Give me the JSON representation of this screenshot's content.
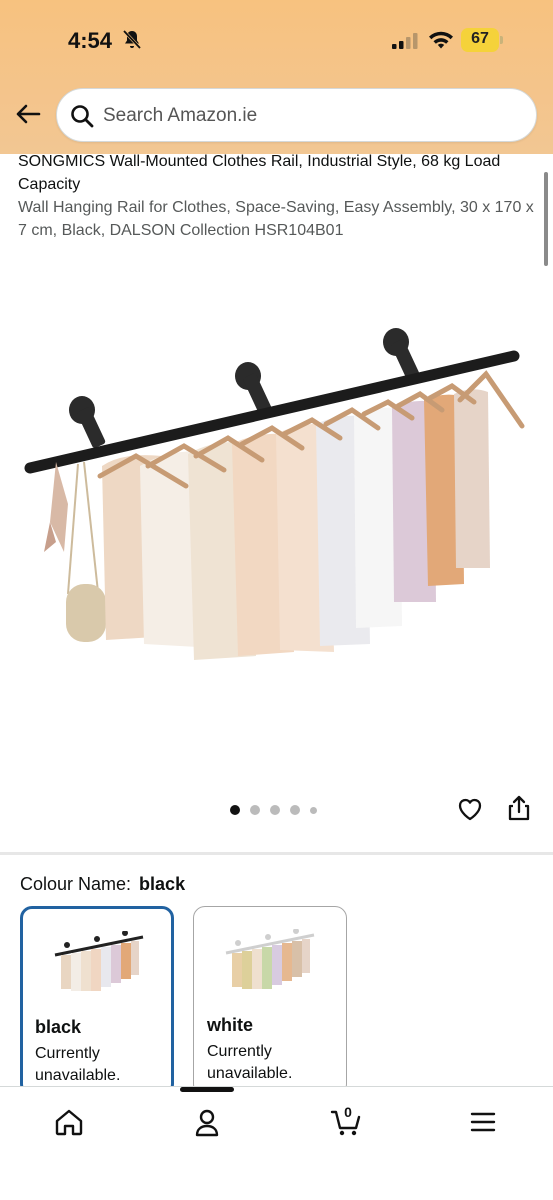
{
  "status_bar": {
    "time": "4:54",
    "battery": "67"
  },
  "search": {
    "placeholder": "Search Amazon.ie"
  },
  "product": {
    "title_brand": "SONGMICS Wall-Mounted Clothes Rail, Industrial Style, 68 kg Load Capacity",
    "title_rest": "Wall Hanging Rail for Clothes, Space-Saving, Easy Assembly, 30 x 170 x 7 cm, Black, DALSON Collection HSR104B01"
  },
  "carousel": {
    "total": 5,
    "active_index": 0
  },
  "colour": {
    "label": "Colour Name:",
    "selected": "black",
    "options": [
      {
        "name": "black",
        "availability": "Currently unavailable."
      },
      {
        "name": "white",
        "availability": "Currently unavailable."
      }
    ]
  },
  "bottom_nav": {
    "cart_count": "0"
  },
  "colors": {
    "header_orange": "#f7c27f",
    "selected_border": "#2162a1"
  }
}
